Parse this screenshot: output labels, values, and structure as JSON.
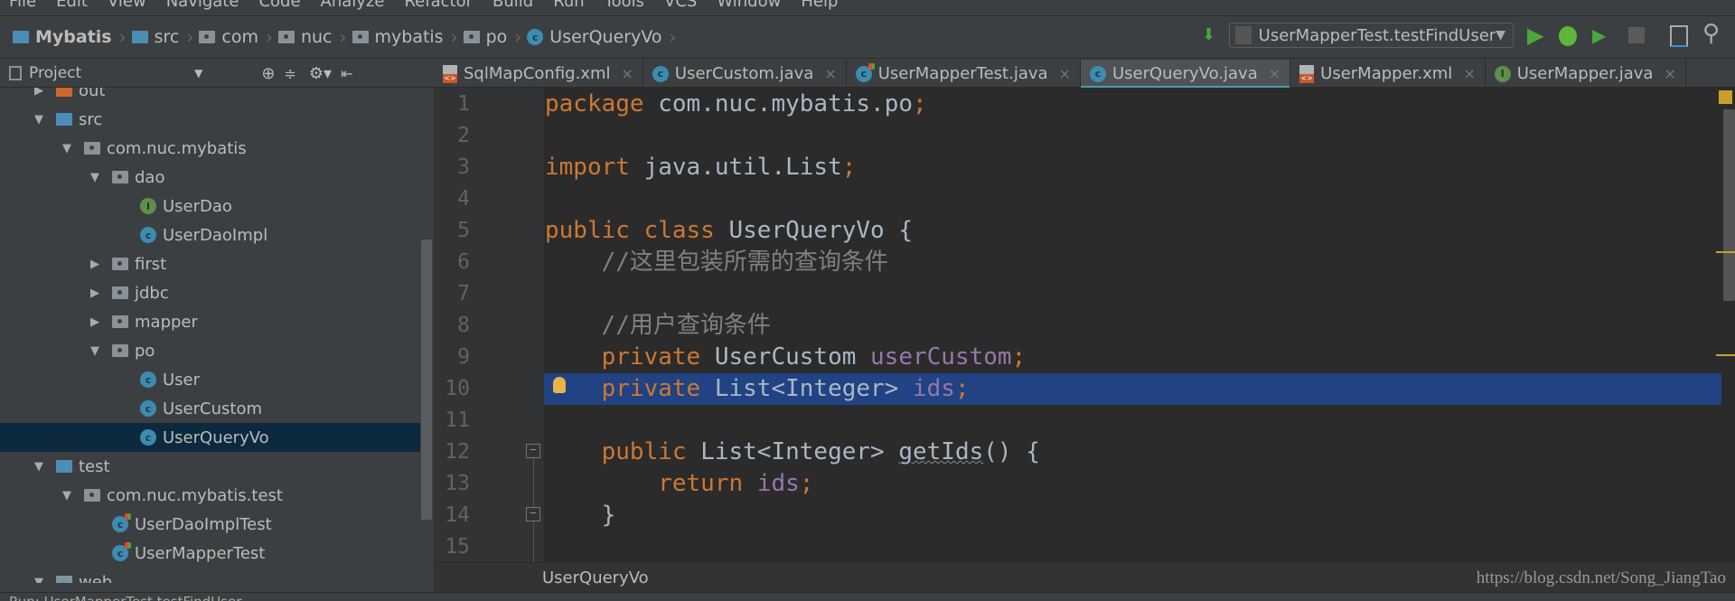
{
  "menu": [
    "File",
    "Edit",
    "View",
    "Navigate",
    "Code",
    "Analyze",
    "Refactor",
    "Build",
    "Run",
    "Tools",
    "VCS",
    "Window",
    "Help"
  ],
  "breadcrumb": [
    "Mybatis",
    "src",
    "com",
    "nuc",
    "mybatis",
    "po",
    "UserQueryVo"
  ],
  "run_config": "UserMapperTest.testFindUser",
  "toolbar_icons": [
    "sort-icon",
    "run-icon",
    "debug-icon",
    "coverage-icon",
    "stop-icon",
    "project-structure-icon",
    "search-icon"
  ],
  "project_panel": {
    "title": "Project"
  },
  "tree": [
    {
      "label": "out",
      "level": 0,
      "type": "folder-orange",
      "expanded": false
    },
    {
      "label": "src",
      "level": 0,
      "type": "folder-blue",
      "expanded": true
    },
    {
      "label": "com.nuc.mybatis",
      "level": 1,
      "type": "package",
      "expanded": true
    },
    {
      "label": "dao",
      "level": 2,
      "type": "package",
      "expanded": true
    },
    {
      "label": "UserDao",
      "level": 3,
      "type": "interface"
    },
    {
      "label": "UserDaoImpl",
      "level": 3,
      "type": "class"
    },
    {
      "label": "first",
      "level": 2,
      "type": "package",
      "expanded": false
    },
    {
      "label": "jdbc",
      "level": 2,
      "type": "package",
      "expanded": false
    },
    {
      "label": "mapper",
      "level": 2,
      "type": "package",
      "expanded": false
    },
    {
      "label": "po",
      "level": 2,
      "type": "package",
      "expanded": true
    },
    {
      "label": "User",
      "level": 3,
      "type": "class"
    },
    {
      "label": "UserCustom",
      "level": 3,
      "type": "class"
    },
    {
      "label": "UserQueryVo",
      "level": 3,
      "type": "class",
      "selected": true
    },
    {
      "label": "test",
      "level": 0,
      "type": "folder-green",
      "expanded": true
    },
    {
      "label": "com.nuc.mybatis.test",
      "level": 1,
      "type": "package",
      "expanded": true
    },
    {
      "label": "UserDaoImplTest",
      "level": 2,
      "type": "test-class"
    },
    {
      "label": "UserMapperTest",
      "level": 2,
      "type": "test-class"
    },
    {
      "label": "web",
      "level": 0,
      "type": "folder-web",
      "expanded": true
    }
  ],
  "tabs": [
    {
      "label": "SqlMapConfig.xml",
      "type": "xml"
    },
    {
      "label": "UserCustom.java",
      "type": "class"
    },
    {
      "label": "UserMapperTest.java",
      "type": "test-class"
    },
    {
      "label": "UserQueryVo.java",
      "type": "class",
      "active": true
    },
    {
      "label": "UserMapper.xml",
      "type": "xml"
    },
    {
      "label": "UserMapper.java",
      "type": "interface"
    }
  ],
  "code": [
    [
      [
        "package ",
        "kw"
      ],
      [
        "com.nuc.mybatis.po",
        ""
      ],
      [
        ";",
        "kw"
      ]
    ],
    [],
    [
      [
        "import ",
        "kw"
      ],
      [
        "java.util.List",
        ""
      ],
      [
        ";",
        "kw"
      ]
    ],
    [],
    [
      [
        "public class ",
        "kw"
      ],
      [
        "UserQueryVo {",
        ""
      ]
    ],
    [
      [
        "    //这里包装所需的查询条件",
        "cm"
      ]
    ],
    [],
    [
      [
        "    //用户查询条件",
        "cm"
      ]
    ],
    [
      [
        "    private ",
        "kw"
      ],
      [
        "UserCustom ",
        ""
      ],
      [
        "userCustom",
        "fd"
      ],
      [
        ";",
        "kw"
      ]
    ],
    [
      [
        "    private ",
        "kw"
      ],
      [
        "List<Integer> ",
        ""
      ],
      [
        "ids",
        "fd"
      ],
      [
        ";",
        "kw"
      ]
    ],
    [],
    [
      [
        "    public ",
        "kw"
      ],
      [
        "List<Integer> ",
        ""
      ],
      [
        "getIds",
        "mt"
      ],
      [
        "() {",
        ""
      ]
    ],
    [
      [
        "        return ",
        "kw"
      ],
      [
        "ids",
        "fd"
      ],
      [
        ";",
        "kw"
      ]
    ],
    [
      [
        "    }",
        ""
      ]
    ],
    []
  ],
  "highlighted_line": 10,
  "editor_breadcrumb": "UserQueryVo",
  "watermark": "https://blog.csdn.net/Song_JiangTao",
  "bottom_bar": "Run:  UserMapperTest.testFindUser",
  "colors": {
    "keyword": "#cc7832",
    "field": "#9876aa",
    "comment": "#808080",
    "text": "#a9b7c6",
    "selection": "#214283",
    "tab_underline": "#4a9ab5"
  }
}
